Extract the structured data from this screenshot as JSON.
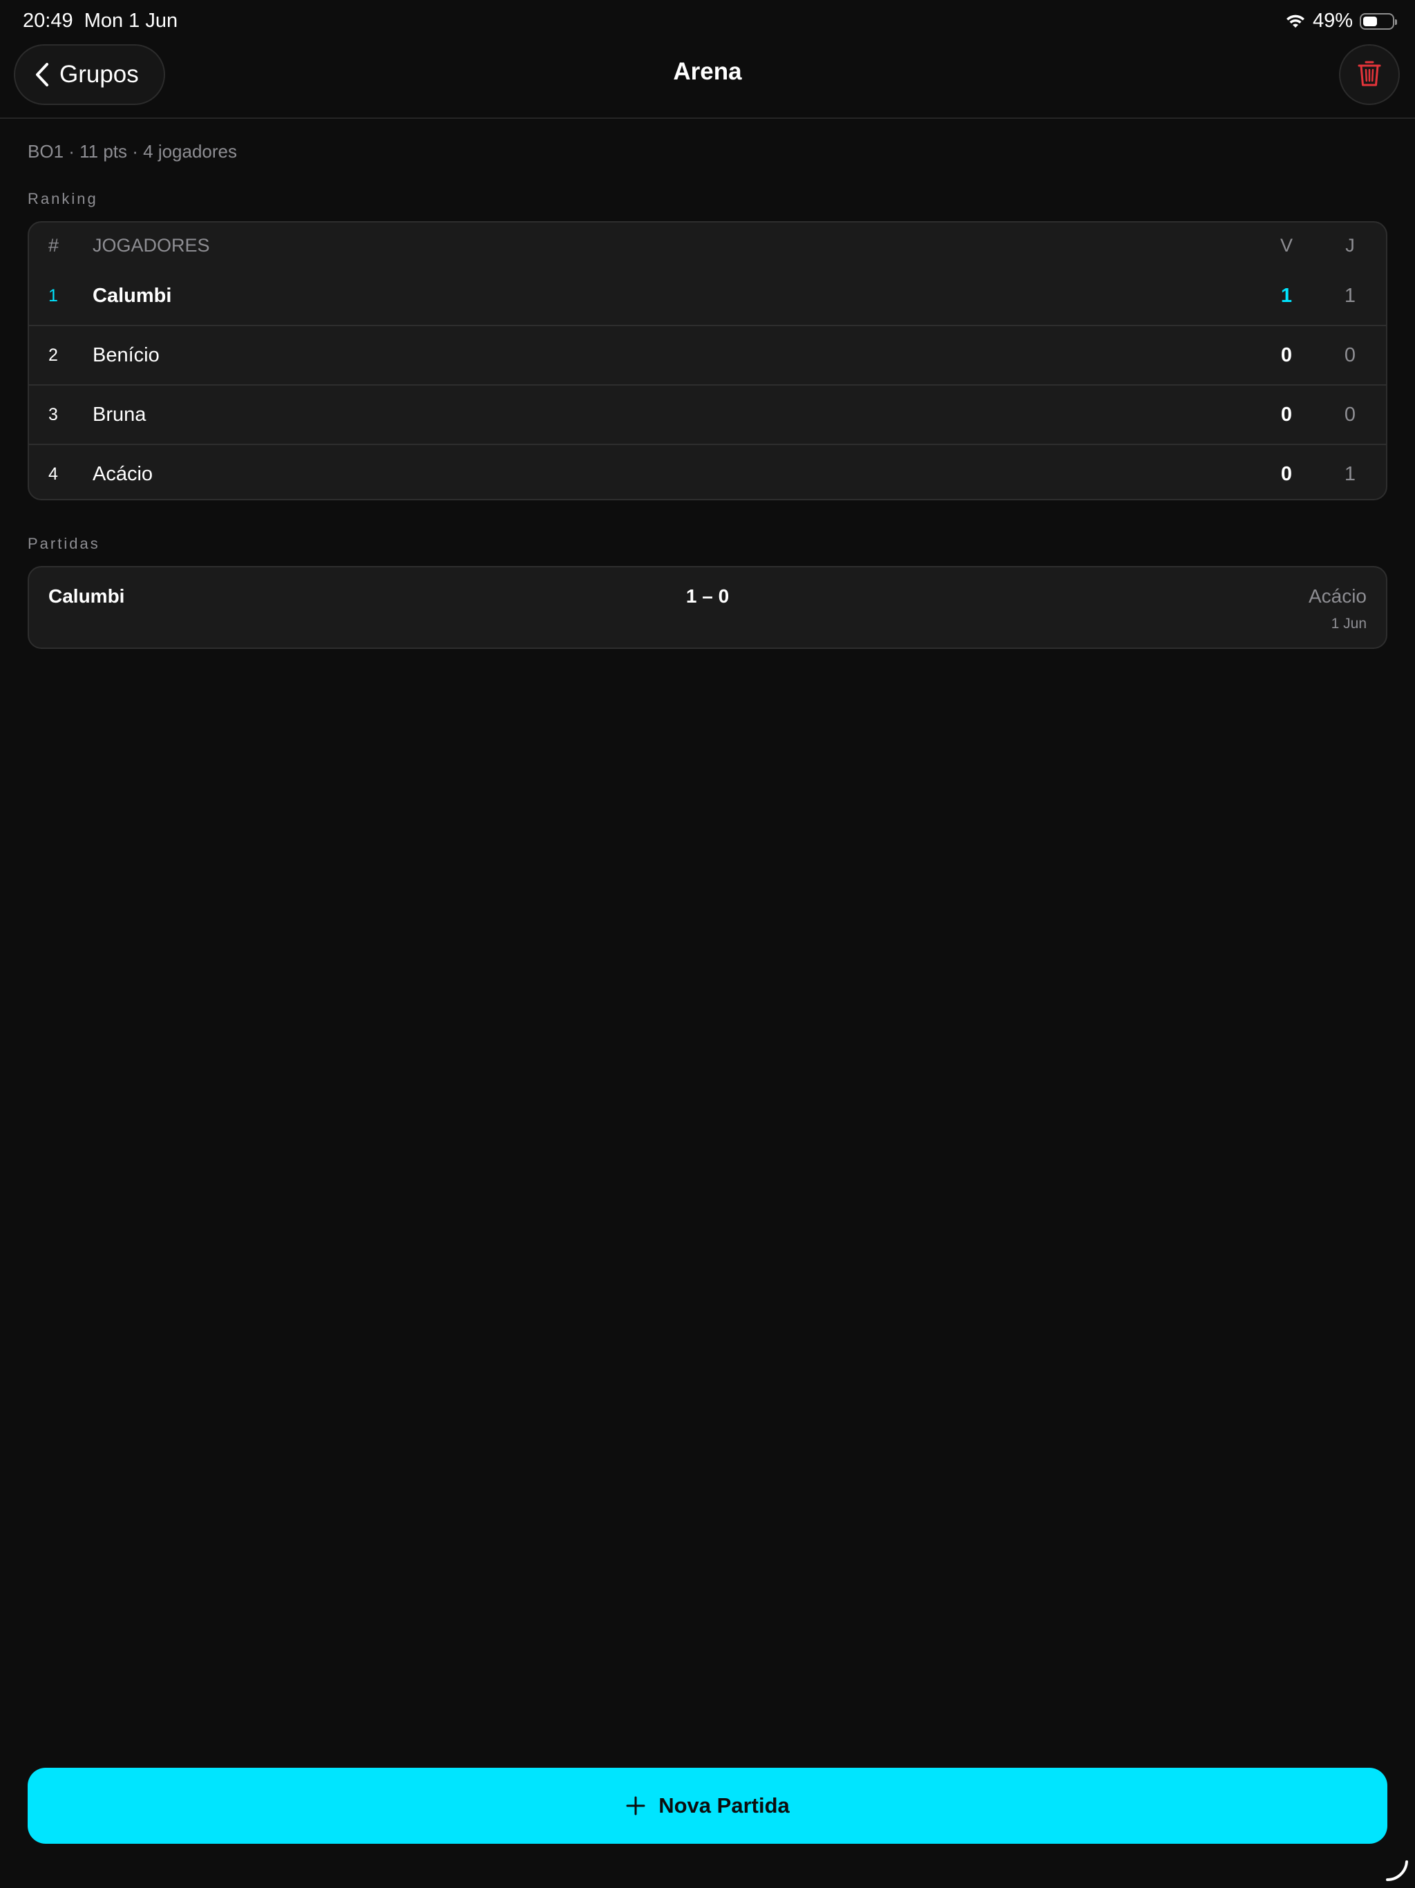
{
  "status_bar": {
    "time": "20:49",
    "date": "Mon 1 Jun",
    "battery_percent": "49%",
    "battery_level": 0.49,
    "icons": [
      "wifi-icon",
      "battery-icon"
    ]
  },
  "nav": {
    "back_label": "Grupos",
    "title": "Arena",
    "delete_icon": "trash-icon",
    "delete_color": "#e5343a"
  },
  "summary": "BO1 · 11 pts · 4 jogadores",
  "ranking": {
    "section_label": "Ranking",
    "header": {
      "rank": "#",
      "name": "JOGADORES",
      "wins": "V",
      "games": "J"
    },
    "rows": [
      {
        "rank": "1",
        "name": "Calumbi",
        "wins": "1",
        "games": "1"
      },
      {
        "rank": "2",
        "name": "Benício",
        "wins": "0",
        "games": "0"
      },
      {
        "rank": "3",
        "name": "Bruna",
        "wins": "0",
        "games": "0"
      },
      {
        "rank": "4",
        "name": "Acácio",
        "wins": "0",
        "games": "1"
      }
    ]
  },
  "matches": {
    "section_label": "Partidas",
    "items": [
      {
        "home": "Calumbi",
        "score": "1 – 0",
        "away": "Acácio",
        "date": "1 Jun"
      }
    ]
  },
  "new_match_button": {
    "label": "Nova Partida",
    "icon": "plus-icon"
  },
  "colors": {
    "accent": "#00e5ff",
    "background": "#0d0d0d",
    "card": "#1b1b1b",
    "muted_text": "#8e8e93",
    "danger": "#e5343a"
  }
}
